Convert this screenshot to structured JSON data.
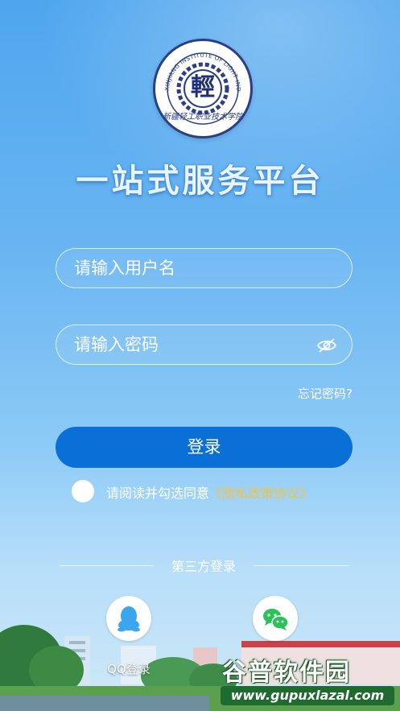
{
  "logo": {
    "ring_text": "XINJIANG INSTITUTE OF LIGHT INDUSTRY TECHNOLOGY",
    "center_char": "輕",
    "bottom_text": "新疆轻工职业技术学院",
    "colors": {
      "ring": "#2b3f86",
      "background": "#ffffff"
    }
  },
  "title": "一站式服务平台",
  "login_form": {
    "username_placeholder": "请输入用户名",
    "password_placeholder": "请输入密码",
    "password_toggle_icon": "eye-off-icon",
    "forgot_password": "忘记密码?",
    "login_button": "登录",
    "agreement_text": "请阅读并勾选同意",
    "agreement_link": "《隐私政策协议》",
    "agreement_checked": false
  },
  "third_party": {
    "label": "第三方登录",
    "providers": [
      {
        "label": "QQ登录",
        "icon": "qq-icon"
      },
      {
        "label": "",
        "icon": "wechat-icon"
      }
    ]
  },
  "watermark": {
    "title": "谷普软件园",
    "url": "www.gupuxlazal.com"
  },
  "colors": {
    "accent": "#0a6fd6",
    "link": "#f0c24a",
    "background_top": "#4fa6ee",
    "wechat_green": "#2bc25b",
    "qq_blue": "#3aa6f0"
  }
}
